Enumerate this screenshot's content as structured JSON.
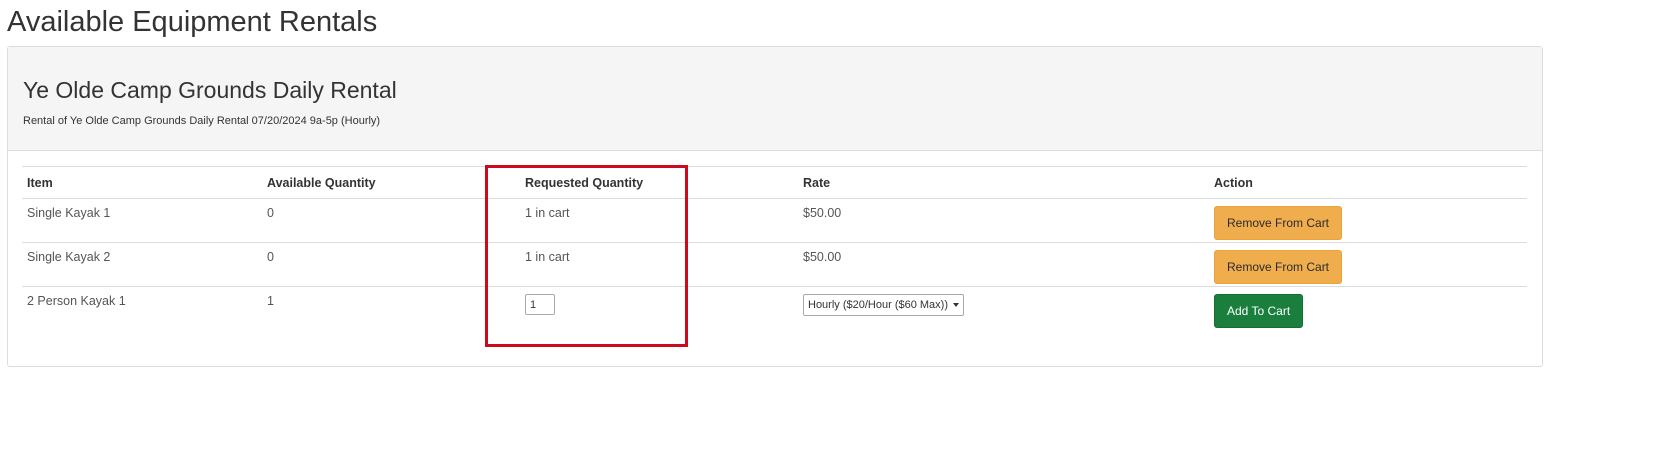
{
  "page": {
    "title": "Available Equipment Rentals"
  },
  "rental": {
    "title": "Ye Olde Camp Grounds Daily Rental",
    "subtitle": "Rental of Ye Olde Camp Grounds Daily Rental 07/20/2024 9a-5p (Hourly)"
  },
  "table": {
    "headers": {
      "item": "Item",
      "available": "Available Quantity",
      "requested": "Requested Quantity",
      "rate": "Rate",
      "action": "Action"
    },
    "rows": [
      {
        "item": "Single Kayak 1",
        "available": "0",
        "requested": "1 in cart",
        "rate": "$50.00",
        "action": "Remove From Cart"
      },
      {
        "item": "Single Kayak 2",
        "available": "0",
        "requested": "1 in cart",
        "rate": "$50.00",
        "action": "Remove From Cart"
      },
      {
        "item": "2 Person Kayak 1",
        "available": "1",
        "requested_value": "1",
        "rate_selected": "Hourly ($20/Hour ($60 Max))",
        "action": "Add To Cart"
      }
    ]
  },
  "colors": {
    "warning_button": "#f0ad4e",
    "success_button": "#1a7f3c",
    "highlight_border": "#cc0a1c",
    "panel_heading_bg": "#f5f5f5"
  },
  "icons": {
    "select_caret": "chevron-down-icon"
  }
}
